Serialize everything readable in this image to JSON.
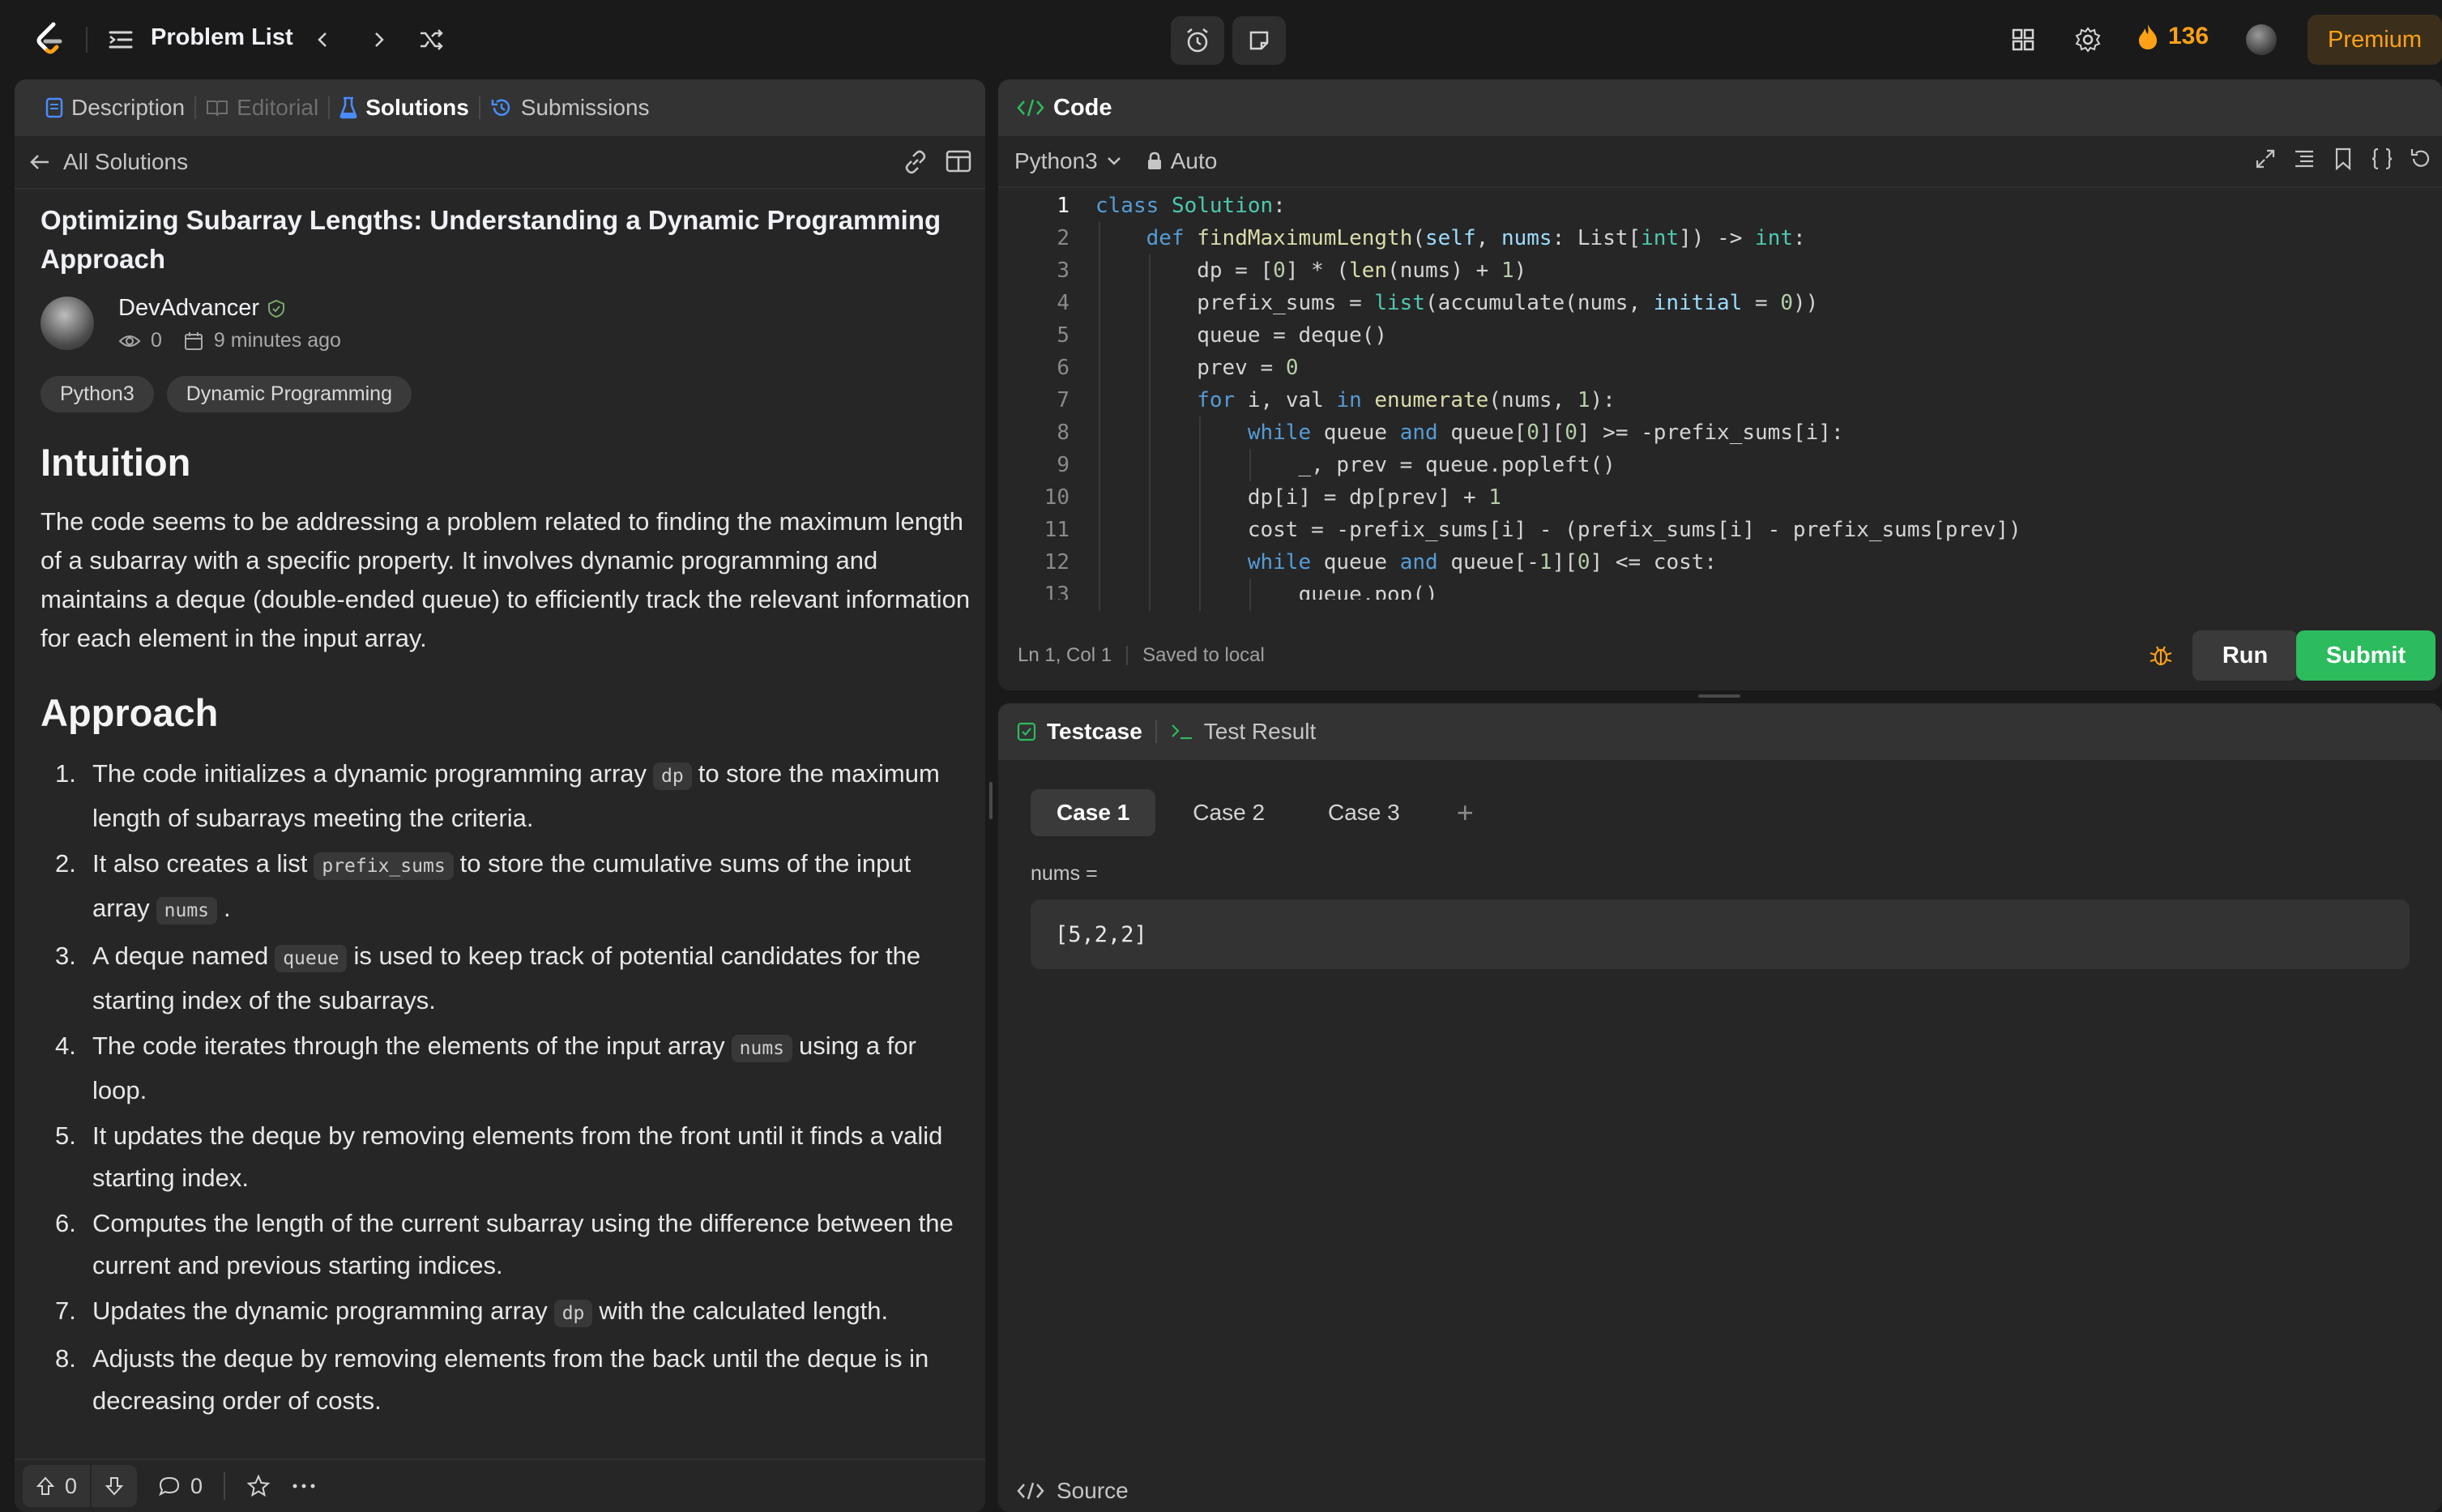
{
  "topbar": {
    "problem_list": "Problem List",
    "streak": "136",
    "premium": "Premium"
  },
  "left": {
    "tabs": [
      {
        "label": "Description"
      },
      {
        "label": "Editorial"
      },
      {
        "label": "Solutions"
      },
      {
        "label": "Submissions"
      }
    ],
    "back": "All Solutions",
    "title": "Optimizing Subarray Lengths: Understanding a Dynamic Programming Approach",
    "author": "DevAdvancer",
    "views": "0",
    "time": "9 minutes ago",
    "tags": [
      "Python3",
      "Dynamic Programming"
    ],
    "h_intuition": "Intuition",
    "intuition": "The code seems to be addressing a problem related to finding the maximum length of a subarray with a specific property. It involves dynamic programming and maintains a deque (double-ended queue) to efficiently track the relevant information for each element in the input array.",
    "h_approach": "Approach",
    "steps": {
      "s1a": "The code initializes a dynamic programming array",
      "s1code": "dp",
      "s1b": "to store the maximum length of subarrays meeting the criteria.",
      "s2a": "It also creates a list",
      "s2code": "prefix_sums",
      "s2b": "to store the cumulative sums of the input array",
      "s2code2": "nums",
      "s2c": ".",
      "s3a": "A deque named",
      "s3code": "queue",
      "s3b": "is used to keep track of potential candidates for the starting index of the subarrays.",
      "s4a": "The code iterates through the elements of the input array",
      "s4code": "nums",
      "s4b": "using a for loop.",
      "s5": "It updates the deque by removing elements from the front until it finds a valid starting index.",
      "s6": "Computes the length of the current subarray using the difference between the current and previous starting indices.",
      "s7a": "Updates the dynamic programming array",
      "s7code": "dp",
      "s7b": "with the calculated length.",
      "s8": "Adjusts the deque by removing elements from the back until the deque is in decreasing order of costs."
    },
    "nums": [
      "1.",
      "2.",
      "3.",
      "4.",
      "5.",
      "6.",
      "7.",
      "8."
    ],
    "upvotes": "0",
    "comments": "0"
  },
  "code": {
    "header": "Code",
    "language": "Python3",
    "mode": "Auto",
    "line_numbers": [
      "1",
      "2",
      "3",
      "4",
      "5",
      "6",
      "7",
      "8",
      "9",
      "10",
      "11",
      "12",
      "13"
    ],
    "status_pos": "Ln 1, Col 1",
    "status_saved": "Saved to local",
    "run": "Run",
    "submit": "Submit"
  },
  "test": {
    "tab_testcase": "Testcase",
    "tab_result": "Test Result",
    "cases": [
      "Case 1",
      "Case 2",
      "Case 3"
    ],
    "add": "+",
    "nums_label": "nums =",
    "nums_value": "[5,2,2]",
    "source": "Source"
  },
  "colors": {
    "accent": "#ffa116",
    "submit": "#2cbb5d",
    "panel": "#262626",
    "background": "#1a1a1a"
  }
}
